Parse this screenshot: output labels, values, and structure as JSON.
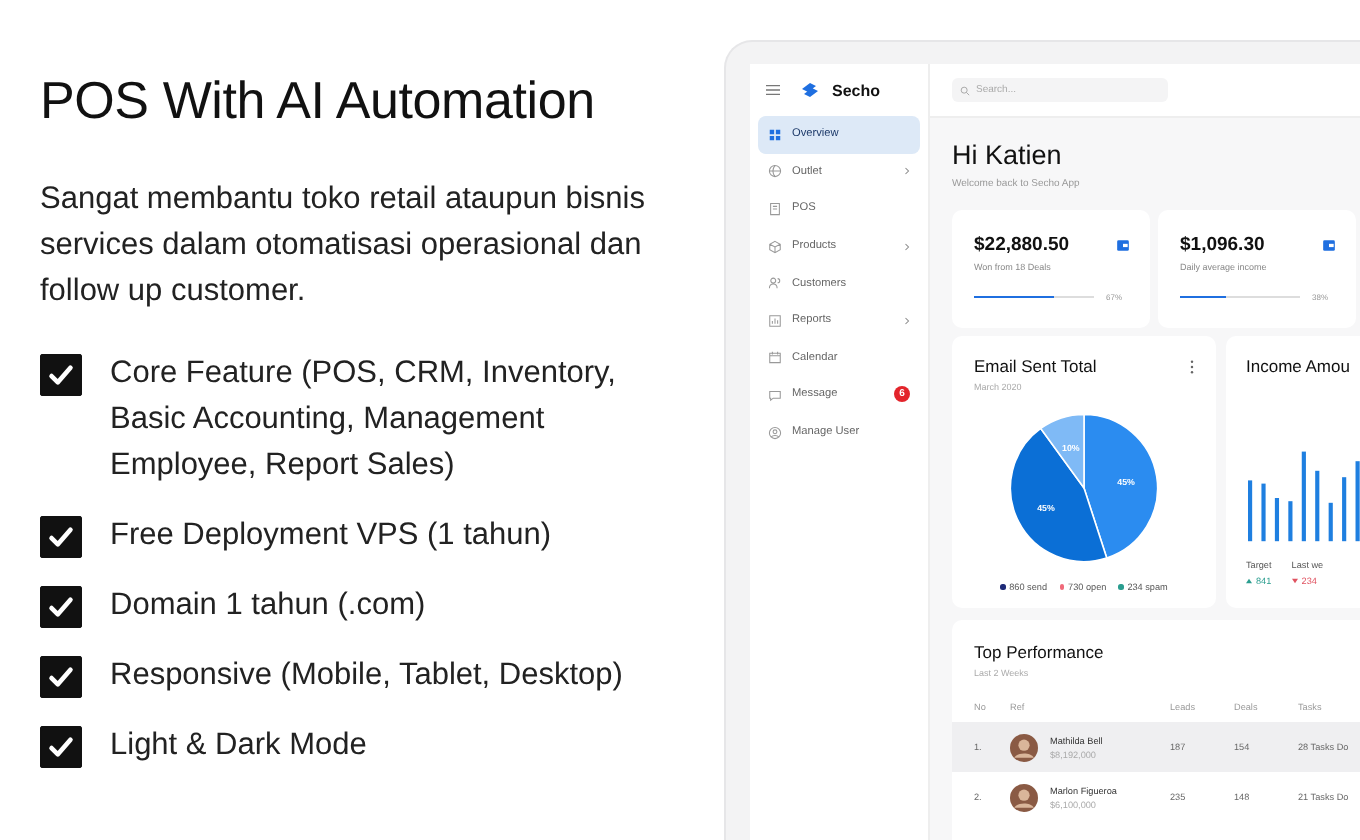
{
  "promo": {
    "title": "POS With AI Automation",
    "description": "Sangat membantu toko retail ataupun bisnis services dalam otomatisasi operasional dan follow up customer.",
    "features": [
      {
        "label": "Core Feature (POS, CRM, Inventory, Basic Accounting, Management Employee, Report Sales)",
        "checked": true
      },
      {
        "label": "Free Deployment VPS (1 tahun)",
        "checked": true
      },
      {
        "label": "Domain  1 tahun (.com)",
        "checked": true
      },
      {
        "label": "Responsive (Mobile, Tablet, Desktop)",
        "checked": true
      },
      {
        "label": "Light & Dark Mode",
        "checked": true
      }
    ]
  },
  "app": {
    "brand": "Secho",
    "search": {
      "placeholder": "Search..."
    },
    "sidebar": {
      "items": [
        {
          "label": "Overview",
          "selected": true,
          "expandable": false
        },
        {
          "label": "Outlet",
          "selected": false,
          "expandable": true
        },
        {
          "label": "POS",
          "selected": false,
          "expandable": false
        },
        {
          "label": "Products",
          "selected": false,
          "expandable": true
        },
        {
          "label": "Customers",
          "selected": false,
          "expandable": false
        },
        {
          "label": "Reports",
          "selected": false,
          "expandable": true
        },
        {
          "label": "Calendar",
          "selected": false,
          "expandable": false
        },
        {
          "label": "Message",
          "selected": false,
          "expandable": false,
          "badge": "6"
        },
        {
          "label": "Manage User",
          "selected": false,
          "expandable": false
        }
      ]
    },
    "greeting": "Hi Katien",
    "subtitle": "Welcome back to Secho App",
    "stats": [
      {
        "value": "$22,880.50",
        "caption": "Won from 18 Deals",
        "level": 0.67,
        "percent": "67%"
      },
      {
        "value": "$1,096.30",
        "caption": "Daily average income",
        "level": 0.38,
        "percent": "38%"
      }
    ],
    "email_card": {
      "title": "Email Sent Total",
      "subtitle": "March 2020",
      "chart_data": {
        "type": "pie",
        "values": [
          45,
          45,
          10
        ],
        "value_labels": [
          "45%",
          "45%",
          "10%"
        ]
      },
      "legend": [
        {
          "label": "860 send",
          "color": "#1e2a78"
        },
        {
          "label": "730 open",
          "color": "#f06a7a"
        },
        {
          "label": "234 spam",
          "color": "#2a9d8f"
        }
      ]
    },
    "income_card": {
      "title": "Income Amou",
      "stats": [
        {
          "label": "Target",
          "value": "841",
          "kind": "up"
        },
        {
          "label": "Last we",
          "value": "234",
          "kind": "down"
        }
      ]
    },
    "performance": {
      "title": "Top Performance",
      "subtitle": "Last 2 Weeks",
      "columns": [
        "No",
        "Ref",
        "Leads",
        "Deals",
        "Tasks"
      ],
      "rows": [
        {
          "no": "1.",
          "name": "Mathilda Bell",
          "amount": "$8,192,000",
          "leads": "187",
          "deals": "154",
          "tasks": "28 Tasks Do",
          "selected": true
        },
        {
          "no": "2.",
          "name": "Marlon Figueroa",
          "amount": "$6,100,000",
          "leads": "235",
          "deals": "148",
          "tasks": "21 Tasks Do",
          "selected": false
        }
      ]
    }
  }
}
